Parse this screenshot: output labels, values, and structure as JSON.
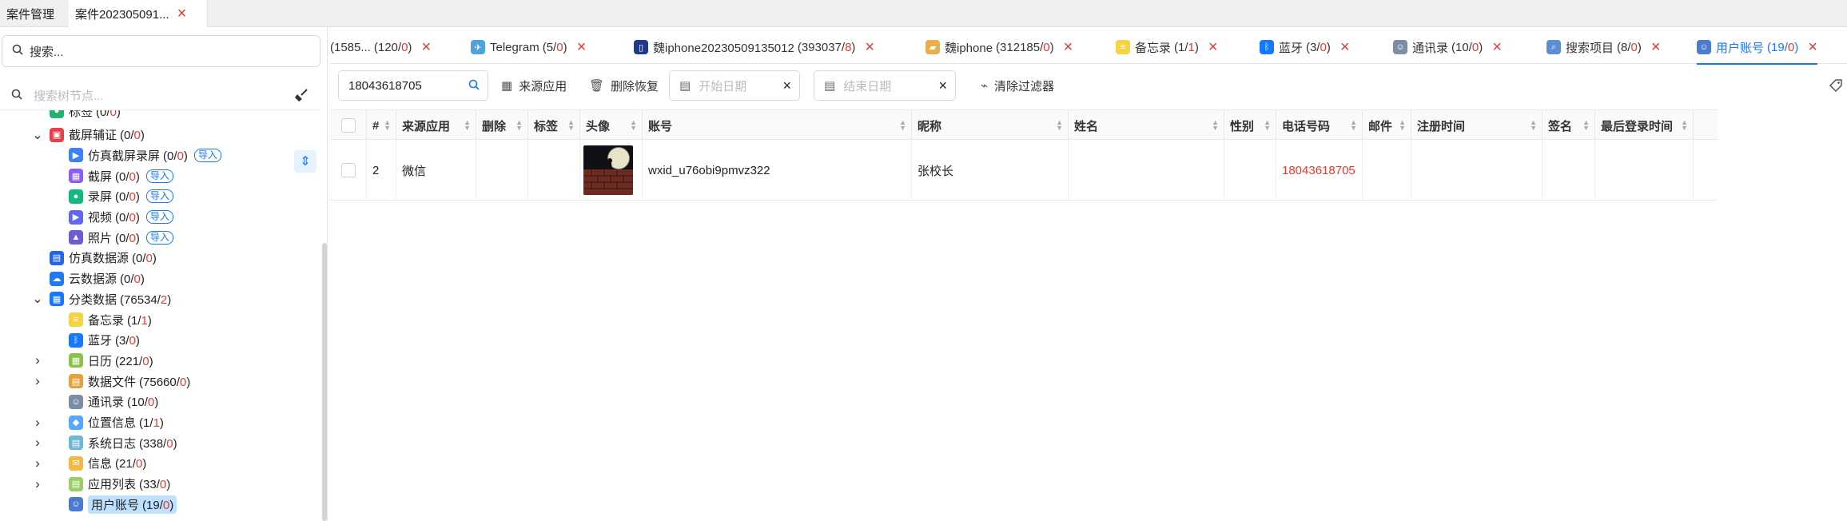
{
  "app_tabs": [
    {
      "label": "案件管理",
      "closable": false
    },
    {
      "label": "案件202305091...",
      "closable": true
    }
  ],
  "left": {
    "search_placeholder": "搜索...",
    "tree_search_placeholder": "搜索树节点...",
    "tree": [
      {
        "label": "标签",
        "count": "0",
        "red": "0",
        "indent": 0,
        "chevron": "",
        "icon": "tag",
        "partial": true
      },
      {
        "label": "截屏辅证",
        "count": "0",
        "red": "0",
        "indent": 0,
        "chevron": "down",
        "icon": "screen-evidence"
      },
      {
        "label": "仿真截屏录屏",
        "count": "0",
        "red": "0",
        "indent": 1,
        "chevron": "",
        "icon": "sim-screen",
        "badge": "导入"
      },
      {
        "label": "截屏",
        "count": "0",
        "red": "0",
        "indent": 1,
        "chevron": "",
        "icon": "screenshot",
        "badge": "导入"
      },
      {
        "label": "录屏",
        "count": "0",
        "red": "0",
        "indent": 1,
        "chevron": "",
        "icon": "record",
        "badge": "导入"
      },
      {
        "label": "视频",
        "count": "0",
        "red": "0",
        "indent": 1,
        "chevron": "",
        "icon": "video",
        "badge": "导入"
      },
      {
        "label": "照片",
        "count": "0",
        "red": "0",
        "indent": 1,
        "chevron": "",
        "icon": "photo",
        "badge": "导入"
      },
      {
        "label": "仿真数据源",
        "count": "0",
        "red": "0",
        "indent": 0,
        "chevron": "",
        "icon": "sim-data"
      },
      {
        "label": "云数据源",
        "count": "0",
        "red": "0",
        "indent": 0,
        "chevron": "",
        "icon": "cloud"
      },
      {
        "label": "分类数据",
        "count": "76534",
        "red": "2",
        "indent": 0,
        "chevron": "down",
        "icon": "category"
      },
      {
        "label": "备忘录",
        "count": "1",
        "red": "1",
        "indent": 1,
        "chevron": "",
        "icon": "memo"
      },
      {
        "label": "蓝牙",
        "count": "3",
        "red": "0",
        "indent": 1,
        "chevron": "",
        "icon": "bluetooth"
      },
      {
        "label": "日历",
        "count": "221",
        "red": "0",
        "indent": 1,
        "chevron": "right",
        "icon": "calendar"
      },
      {
        "label": "数据文件",
        "count": "75660",
        "red": "0",
        "indent": 1,
        "chevron": "right",
        "icon": "data-file"
      },
      {
        "label": "通讯录",
        "count": "10",
        "red": "0",
        "indent": 1,
        "chevron": "",
        "icon": "contacts"
      },
      {
        "label": "位置信息",
        "count": "1",
        "red": "1",
        "indent": 1,
        "chevron": "right",
        "icon": "location"
      },
      {
        "label": "系统日志",
        "count": "338",
        "red": "0",
        "indent": 1,
        "chevron": "right",
        "icon": "syslog"
      },
      {
        "label": "信息",
        "count": "21",
        "red": "0",
        "indent": 1,
        "chevron": "right",
        "icon": "message"
      },
      {
        "label": "应用列表",
        "count": "33",
        "red": "0",
        "indent": 1,
        "chevron": "right",
        "icon": "app-list"
      },
      {
        "label": "用户账号",
        "count": "19",
        "red": "0",
        "indent": 1,
        "chevron": "",
        "icon": "user-account",
        "selected": true
      }
    ]
  },
  "right_tabs": [
    {
      "label": "(1585...",
      "count": "120",
      "red": "0",
      "icon": "",
      "active": false
    },
    {
      "label": "Telegram",
      "count": "5",
      "red": "0",
      "icon": "telegram",
      "active": false
    },
    {
      "label": "魏iphone20230509135012",
      "count": "393037",
      "red": "8",
      "icon": "phone",
      "active": false
    },
    {
      "label": "魏iphone",
      "count": "312185",
      "red": "0",
      "icon": "folder",
      "active": false
    },
    {
      "label": "备忘录",
      "count": "1",
      "red": "1",
      "icon": "memo",
      "active": false
    },
    {
      "label": "蓝牙",
      "count": "3",
      "red": "0",
      "icon": "bluetooth",
      "active": false
    },
    {
      "label": "通讯录",
      "count": "10",
      "red": "0",
      "icon": "contacts",
      "active": false
    },
    {
      "label": "搜索项目",
      "count": "8",
      "red": "0",
      "icon": "search-items",
      "active": false
    },
    {
      "label": "用户账号",
      "count": "19",
      "red": "0",
      "icon": "user-account",
      "active": true
    }
  ],
  "toolbar": {
    "search_value": "18043618705",
    "source_app": "来源应用",
    "delete_restore": "删除恢复",
    "start_date_placeholder": "开始日期",
    "end_date_placeholder": "结束日期",
    "clear_filter": "清除过滤器"
  },
  "table": {
    "columns": [
      "#",
      "来源应用",
      "删除",
      "标签",
      "头像",
      "账号",
      "昵称",
      "姓名",
      "性别",
      "电话号码",
      "邮件",
      "注册时间",
      "签名",
      "最后登录时间"
    ],
    "rows": [
      {
        "index": "2",
        "source_app": "微信",
        "deleted": "",
        "tag": "",
        "avatar": "avatar-image",
        "account": "wxid_u76obi9pmvz322",
        "nickname": "张校长",
        "name": "",
        "gender": "",
        "phone": "18043618705",
        "email": "",
        "reg_time": "",
        "signature": "",
        "last_login": ""
      }
    ]
  },
  "colors": {
    "accent": "#1677ff",
    "red": "#e53935",
    "selected_bg": "#bfe0ff"
  }
}
